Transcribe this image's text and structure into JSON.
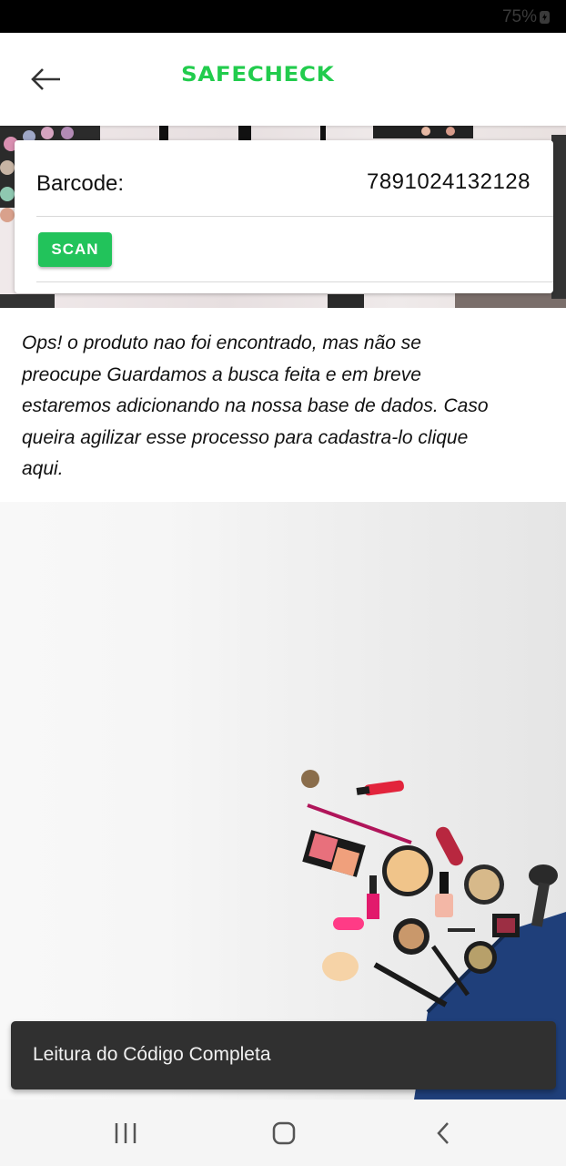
{
  "status_bar": {
    "battery": "75%",
    "battery_icon": "charging-battery-icon"
  },
  "app_bar": {
    "back_icon": "arrow-left-icon",
    "brand": "SAFECHECK",
    "brand_color": "#22cc4d"
  },
  "barcode": {
    "label": "Barcode:",
    "value": "7891024132128",
    "scan_label": "SCAN",
    "accent": "#22c35b"
  },
  "message": {
    "text": "Ops! o produto nao foi encontrado, mas não se preocupe Guardamos a busca feita e em breve estaremos adicionando na nossa base de dados. Caso queira agilizar esse processo para cadastra-",
    "link_text": "lo clique aqui."
  },
  "snackbar": {
    "text": "Leitura do Código Completa"
  },
  "nav_bar": {
    "icons": [
      "recent-apps-icon",
      "home-icon",
      "back-icon"
    ]
  }
}
